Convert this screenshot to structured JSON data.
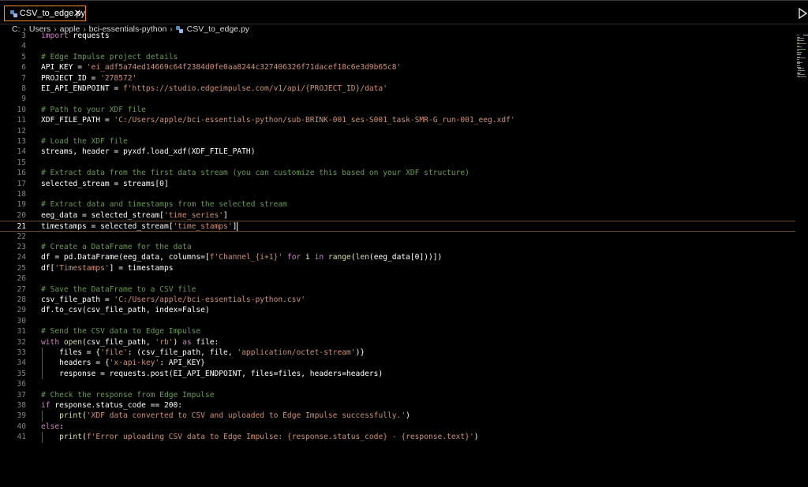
{
  "tab": {
    "label": "CSV_to_edge.py",
    "close": "✕"
  },
  "breadcrumb": [
    "C:",
    "Users",
    "apple",
    "bci-essentials-python",
    "CSV_to_edge.py"
  ],
  "current_line": 21,
  "lines": [
    {
      "n": "3",
      "t": "import requests"
    },
    {
      "n": "4",
      "t": ""
    },
    {
      "n": "5",
      "t": "# Edge Impulse project details"
    },
    {
      "n": "6",
      "t": "API_KEY = 'ei_adf5a74ed14669c64f2384d0fe0aa8244c327406326f71dacef18c6e3d9b65c8'"
    },
    {
      "n": "7",
      "t": "PROJECT_ID = '278572'"
    },
    {
      "n": "8",
      "t": "EI_API_ENDPOINT = f'https://studio.edgeimpulse.com/v1/api/{PROJECT_ID}/data'"
    },
    {
      "n": "9",
      "t": ""
    },
    {
      "n": "10",
      "t": "# Path to your XDF file"
    },
    {
      "n": "11",
      "t": "XDF_FILE_PATH = 'C:/Users/apple/bci-essentials-python/sub-BRINK-001_ses-S001_task-SMR-G_run-001_eeg.xdf'"
    },
    {
      "n": "12",
      "t": ""
    },
    {
      "n": "13",
      "t": "# Load the XDF file"
    },
    {
      "n": "14",
      "t": "streams, header = pyxdf.load_xdf(XDF_FILE_PATH)"
    },
    {
      "n": "15",
      "t": ""
    },
    {
      "n": "16",
      "t": "# Extract data from the first data stream (you can customize this based on your XDF structure)"
    },
    {
      "n": "17",
      "t": "selected_stream = streams[0]"
    },
    {
      "n": "18",
      "t": ""
    },
    {
      "n": "19",
      "t": "# Extract data and timestamps from the selected stream"
    },
    {
      "n": "20",
      "t": "eeg_data = selected_stream['time_series']"
    },
    {
      "n": "21",
      "t": "timestamps = selected_stream['time_stamps']"
    },
    {
      "n": "22",
      "t": ""
    },
    {
      "n": "23",
      "t": "# Create a DataFrame for the data"
    },
    {
      "n": "24",
      "t": "df = pd.DataFrame(eeg_data, columns=[f'Channel_{i+1}' for i in range(len(eeg_data[0]))])"
    },
    {
      "n": "25",
      "t": "df['Timestamps'] = timestamps"
    },
    {
      "n": "26",
      "t": ""
    },
    {
      "n": "27",
      "t": "# Save the DataFrame to a CSV file"
    },
    {
      "n": "28",
      "t": "csv_file_path = 'C:/Users/apple/bci-essentials-python.csv'"
    },
    {
      "n": "29",
      "t": "df.to_csv(csv_file_path, index=False)"
    },
    {
      "n": "30",
      "t": ""
    },
    {
      "n": "31",
      "t": "# Send the CSV data to Edge Impulse"
    },
    {
      "n": "32",
      "t": "with open(csv_file_path, 'rb') as file:"
    },
    {
      "n": "33",
      "t": "    files = {'file': (csv_file_path, file, 'application/octet-stream')}"
    },
    {
      "n": "34",
      "t": "    headers = {'x-api-key': API_KEY}"
    },
    {
      "n": "35",
      "t": "    response = requests.post(EI_API_ENDPOINT, files=files, headers=headers)"
    },
    {
      "n": "36",
      "t": ""
    },
    {
      "n": "37",
      "t": "# Check the response from Edge Impulse"
    },
    {
      "n": "38",
      "t": "if response.status_code == 200:"
    },
    {
      "n": "39",
      "t": "    print('XDF data converted to CSV and uploaded to Edge Impulse successfully.')"
    },
    {
      "n": "40",
      "t": "else:"
    },
    {
      "n": "41",
      "t": "    print(f'Error uploading CSV data to Edge Impulse: {response.status_code} - {response.text}')"
    }
  ],
  "colors": {
    "tab_border": "#f28c28",
    "comment": "#6a9955",
    "string": "#ce9178",
    "keyword": "#c586c0",
    "line_number": "#858585",
    "background": "#000000"
  },
  "icons": [
    "python-file-icon",
    "close-icon",
    "run-icon",
    "chevron-right-icon"
  ]
}
